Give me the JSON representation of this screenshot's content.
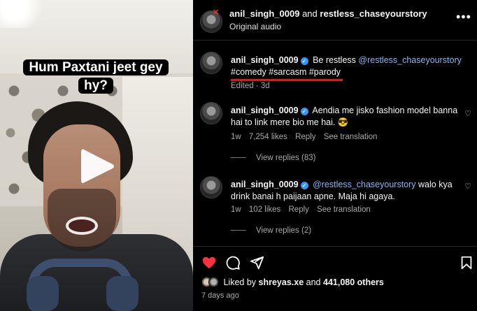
{
  "video": {
    "caption_line1": "Hum Paxtani jeet gey",
    "caption_line2": "hy?"
  },
  "header": {
    "author": "anil_singh_0009",
    "joiner": "and",
    "collaborator": "restless_chaseyourstory",
    "audio": "Original audio",
    "more": "•••"
  },
  "post_caption": {
    "user": "anil_singh_0009",
    "text": "Be restless",
    "mention": "@restless_chaseyourstory",
    "hashtags": "#comedy #sarcasm #parody",
    "meta": "Edited · 3d"
  },
  "comments": [
    {
      "user": "anil_singh_0009",
      "line1": "Aendia me jisko fashion model banna",
      "line2": "hai to link mere bio me hai. 😎",
      "age": "1w",
      "likes": "7,254 likes",
      "reply": "Reply",
      "translate": "See translation",
      "view_replies": "View replies (83)"
    },
    {
      "user": "anil_singh_0009",
      "mention": "@restless_chaseyourstory",
      "line1_rest": "walo kya",
      "line2": "drink banai h paijaan apne. Maja hi agaya.",
      "age": "1w",
      "likes": "102 likes",
      "reply": "Reply",
      "translate": "See translation",
      "view_replies": "View replies (2)"
    }
  ],
  "likes": {
    "prefix": "Liked by",
    "user": "shreyas.xe",
    "and": "and",
    "others": "441,080 others"
  },
  "posted": "7 days ago",
  "colors": {
    "background": "#000000",
    "link": "#8ab4f8",
    "liked_heart": "#ff3040",
    "verified": "#3797f0",
    "highlight_underline": "#e8141b"
  },
  "icons": [
    "play-icon",
    "more-icon",
    "verified-icon",
    "heart-icon",
    "comment-icon",
    "share-icon",
    "bookmark-icon"
  ]
}
